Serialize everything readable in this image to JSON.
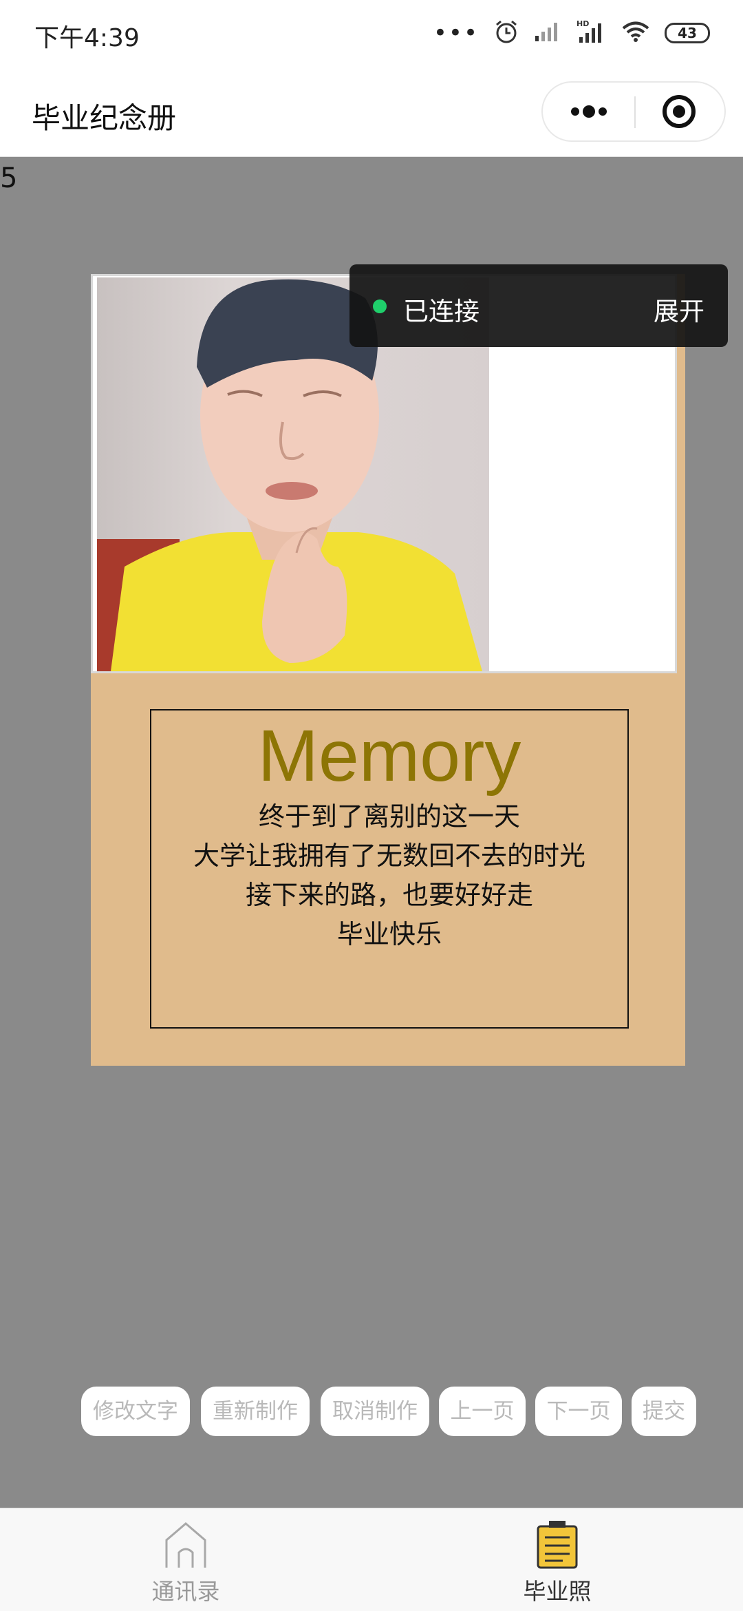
{
  "status_bar": {
    "time": "下午4:39",
    "battery": "43",
    "icons": [
      "more-dots-icon",
      "alarm-icon",
      "signal-icon",
      "hd-signal-icon",
      "wifi-icon",
      "battery-icon"
    ]
  },
  "nav": {
    "title": "毕业纪念册",
    "more_icon": "more-dots-icon",
    "close_icon": "target-icon"
  },
  "page_number": "5",
  "card": {
    "background_color": "#e0bb8c",
    "title": "Memory",
    "title_color": "#8d7505",
    "lines": [
      "终于到了离别的这一天",
      "大学让我拥有了无数回不去的时光",
      "接下来的路，也要好好走",
      "毕业快乐"
    ]
  },
  "toast": {
    "status": "已连接",
    "expand": "展开",
    "dot_color": "#1fcf6b"
  },
  "actions": [
    "修改文字",
    "重新制作",
    "取消制作",
    "上一页",
    "下一页",
    "提交"
  ],
  "tab_bar": {
    "tabs": [
      {
        "label": "通讯录",
        "icon": "home-icon",
        "active": false
      },
      {
        "label": "毕业照",
        "icon": "clipboard-icon",
        "active": true
      }
    ],
    "inactive_color": "#999999",
    "active_color": "#333333",
    "active_icon_color": "#f2c53a"
  }
}
